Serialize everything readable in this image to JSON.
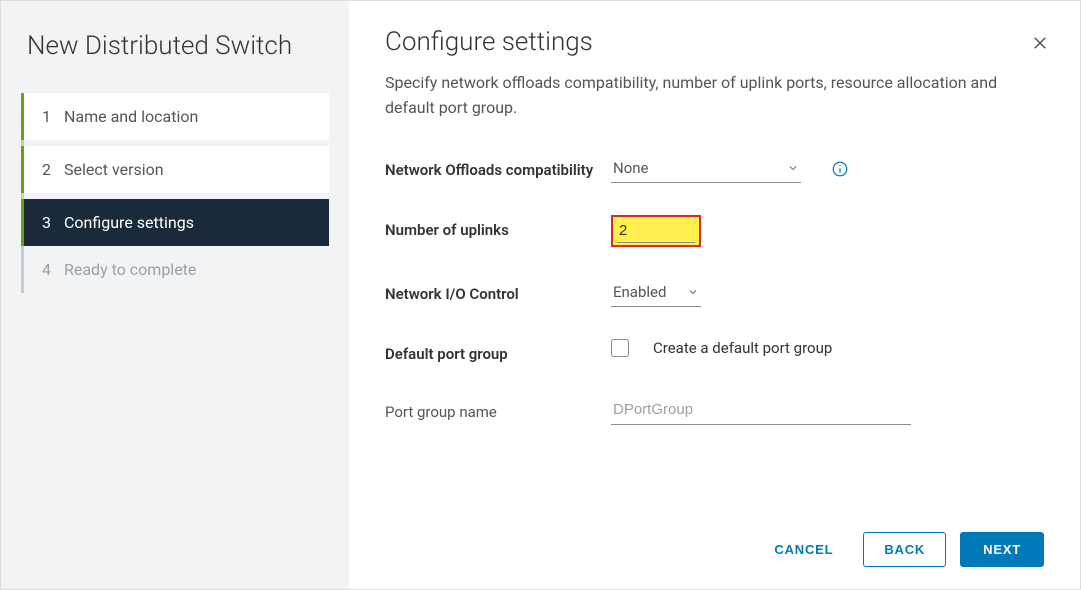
{
  "sidebar": {
    "title": "New Distributed Switch",
    "steps": [
      {
        "num": "1",
        "label": "Name and location"
      },
      {
        "num": "2",
        "label": "Select version"
      },
      {
        "num": "3",
        "label": "Configure settings"
      },
      {
        "num": "4",
        "label": "Ready to complete"
      }
    ]
  },
  "main": {
    "title": "Configure settings",
    "description": "Specify network offloads compatibility, number of uplink ports, resource allocation and default port group."
  },
  "form": {
    "offloads_label": "Network Offloads compatibility",
    "offloads_value": "None",
    "uplinks_label": "Number of uplinks",
    "uplinks_value": "2",
    "nioc_label": "Network I/O Control",
    "nioc_value": "Enabled",
    "pg_label": "Default port group",
    "pg_checkbox_label": "Create a default port group",
    "pgname_label": "Port group name",
    "pgname_placeholder": "DPortGroup"
  },
  "footer": {
    "cancel": "CANCEL",
    "back": "BACK",
    "next": "NEXT"
  }
}
